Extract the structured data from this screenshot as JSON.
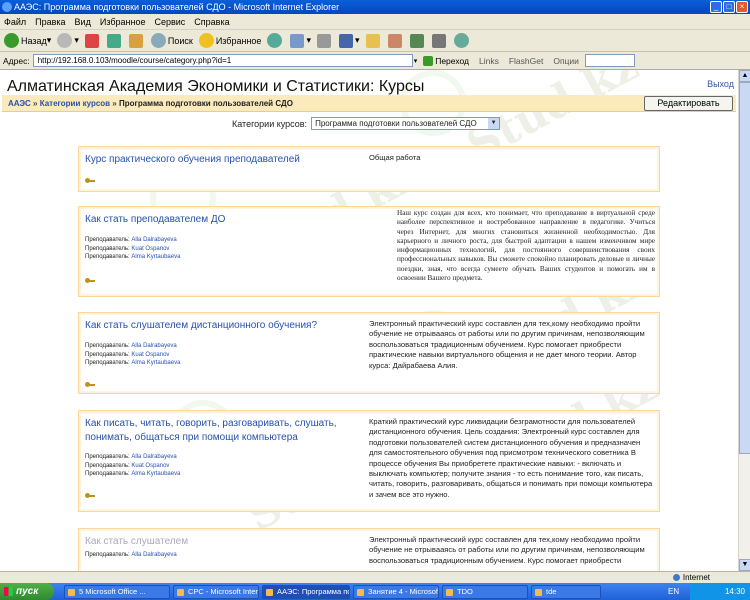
{
  "window": {
    "title": "ААЭС: Программа подготовки пользователей СДО - Microsoft Internet Explorer"
  },
  "menu": [
    "Файл",
    "Правка",
    "Вид",
    "Избранное",
    "Сервис",
    "Справка"
  ],
  "toolbar": {
    "back": "Назад",
    "search": "Поиск",
    "favorites": "Избранное"
  },
  "address": {
    "label": "Адрес:",
    "url": "http://192.168.0.103/moodle/course/category.php?id=1",
    "go": "Переход",
    "links": "Links",
    "flashget": "FlashGet",
    "options": "Опции"
  },
  "page": {
    "site_title": "Алматинская Академия Экономики и Статистики: Курсы",
    "logout": "Выход",
    "breadcrumb": {
      "home": "ААЭС",
      "sep1": " » ",
      "categories": "Категории курсов",
      "sep2": " » ",
      "current": "Программа подготовки пользователей СДО"
    },
    "edit_button": "Редактировать",
    "category_label": "Категории курсов:",
    "category_value": "Программа подготовки пользователей СДО"
  },
  "courses": [
    {
      "title": "Курс практического обучения преподавателей",
      "teachers": [],
      "summary": "Общая работа"
    },
    {
      "title": "Как стать преподавателем ДО",
      "teachers": [
        {
          "role": "Преподаватель:",
          "name": "Alla Dalrabayeva"
        },
        {
          "role": "Преподаватель:",
          "name": "Kuat Ospanov"
        },
        {
          "role": "Преподаватель:",
          "name": "Alma Kyrtaubaeva"
        }
      ],
      "summary": "Наш курс создан для всех, кто понимает, что преподавание в виртуальной среде наиболее перспективное и востребованное направление в педагогике. Учиться через Интернет, для многих становиться жизненной необходимостью. Для карьерного и личного роста, для быстрой адаптации в нашем изменчивом мире информационных технологий, для постоянного совершенствования своих профессиональных навыков. Вы сможете спокойно планировать деловые и личные поездки, зная, что всегда сумеете обучать Ваших студентов и помогать им в освоении Вашего предмета."
    },
    {
      "title": "Как стать слушателем дистанционного обучения?",
      "teachers": [
        {
          "role": "Преподаватель:",
          "name": "Alla Dalrabayeva"
        },
        {
          "role": "Преподаватель:",
          "name": "Kuat Ospanov"
        },
        {
          "role": "Преподаватель:",
          "name": "Alma Kyrtaubaeva"
        }
      ],
      "summary": "Электронный практический курс составлен для тех,кому необходимо пройти обучение не отрывааясь от работы или по другим причинам, непозволяющим воспользоваться традиционным обучением. Курс помогает приобрести практические навыки виртуального общения и не дает много теории. Автор курса: Дайрабаева Алия."
    },
    {
      "title": "Как писать, читать, говорить, разговаривать, слушать, понимать, общаться при помощи компьютера",
      "teachers": [
        {
          "role": "Преподаватель:",
          "name": "Alla Dalrabayeva"
        },
        {
          "role": "Преподаватель:",
          "name": "Kuat Ospanov"
        },
        {
          "role": "Преподаватель:",
          "name": "Alma Kyrtaubaeva"
        }
      ],
      "summary": "Краткий практический курс ликвидации безграмотности для пользователей дистанционного обучения. Цель создания: Электронный курс составлен для подготовки пользователей систем дистанционного обучения и предназначен для самостоятельного обучения под присмотром технического советника В процессе обучения Вы приобретете практические навыки: - включать и выключать компьютер; получите знания - то есть понимание того, как писать, читать, говорить, разговаривать, общаться и понимать при помощи компьютера и зачем все это нужно."
    },
    {
      "title": "Как стать слушателем",
      "teachers": [
        {
          "role": "Преподаватель:",
          "name": "Alla Dalrabayeva"
        }
      ],
      "summary": "Электронный практический курс составлен для тех,кому необходимо пройти обучение не отрывааясь от работы или по другим причинам, непозволяющим воспользоваться традиционным обучением. Курс помогает приобрести"
    }
  ],
  "status": {
    "zone": "Internet"
  },
  "taskbar": {
    "start": "пуск",
    "tasks": [
      "5 Microsoft Office ...",
      "СРС - Microsoft Inter...",
      "ААЭС: Программа по...",
      "Занятие 4 - Microsof...",
      "TDO",
      "tde"
    ],
    "lang": "EN",
    "clock": "14:30"
  },
  "watermark": "Stud.kz",
  "colors": {
    "link": "#2650b0",
    "navbar_bg": "#fbeabb",
    "course_border": "#fbd79c"
  }
}
